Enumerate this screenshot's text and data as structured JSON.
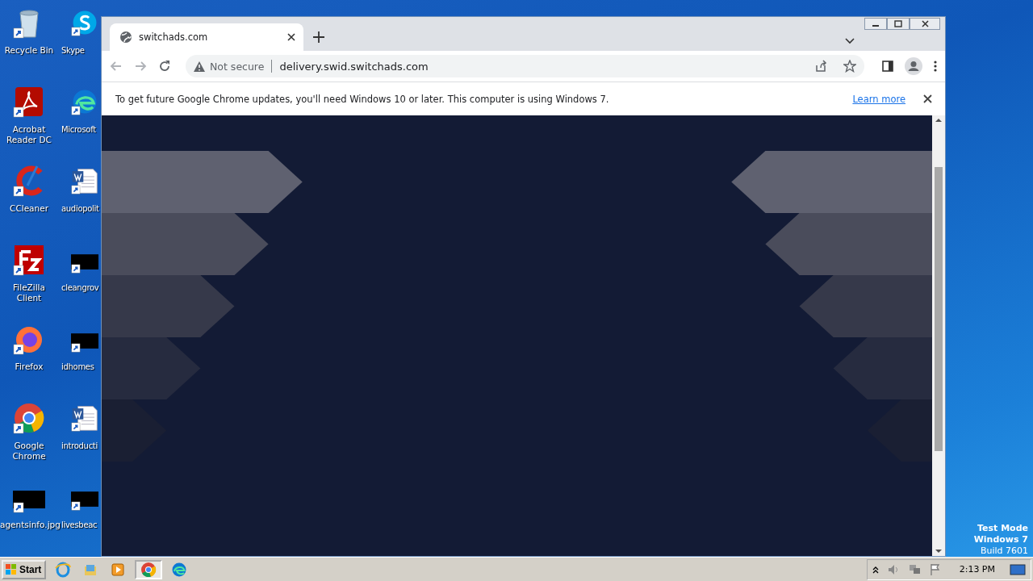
{
  "desktop_icons_left": [
    {
      "label": "Recycle Bin",
      "kind": "recycle"
    },
    {
      "label": "Acrobat Reader DC",
      "kind": "pdf"
    },
    {
      "label": "CCleaner",
      "kind": "ccleaner"
    },
    {
      "label": "FileZilla Client",
      "kind": "filezilla"
    },
    {
      "label": "Firefox",
      "kind": "firefox"
    },
    {
      "label": "Google Chrome",
      "kind": "chrome"
    },
    {
      "label": "agentsinfo.jpg",
      "kind": "blank"
    }
  ],
  "desktop_icons_right": [
    {
      "label": "Skype",
      "kind": "skype"
    },
    {
      "label": "Microsoft",
      "kind": "edge"
    },
    {
      "label": "audiopolit",
      "kind": "word"
    },
    {
      "label": "cleangrov",
      "kind": "blank"
    },
    {
      "label": "idhomes",
      "kind": "blank"
    },
    {
      "label": "introducti",
      "kind": "word"
    },
    {
      "label": "livesbeac",
      "kind": "blank"
    }
  ],
  "browser": {
    "tab": {
      "title": "switchads.com"
    },
    "address_bar": {
      "security": "Not secure",
      "url": "delivery.swid.switchads.com"
    },
    "infobar": {
      "message": "To get future Google Chrome updates, you'll need Windows 10 or later. This computer is using Windows 7.",
      "link": "Learn more"
    }
  },
  "desktop_notice": [
    "Test Mode",
    "Windows 7",
    "Build 7601"
  ],
  "taskbar": {
    "start": "Start",
    "pinned": [
      {
        "kind": "ie",
        "selected": false
      },
      {
        "kind": "explorer",
        "selected": false
      },
      {
        "kind": "media",
        "selected": false
      },
      {
        "kind": "chrome",
        "selected": true
      },
      {
        "kind": "edge",
        "selected": false
      }
    ],
    "clock": "2:13 PM"
  }
}
